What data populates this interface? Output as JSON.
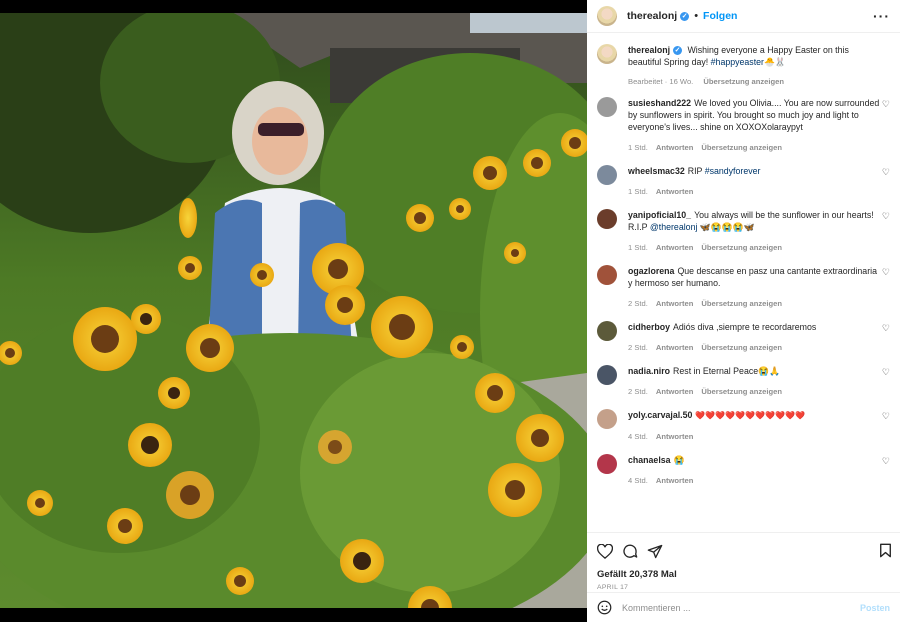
{
  "header": {
    "username": "therealonj",
    "follow_label": "Folgen",
    "more_icon": "more-horizontal-icon",
    "dot": "•"
  },
  "caption": {
    "username": "therealonj",
    "text": "Wishing everyone a Happy Easter on this beautiful Spring day!",
    "hashtag": "#happyeaster",
    "emoji": "🐣🐰",
    "edited": "Bearbeitet · 16 Wo.",
    "translate": "Übersetzung anzeigen"
  },
  "comments": [
    {
      "username": "susieshand222",
      "text": "We loved you Olivia.... You are now surrounded by sunflowers in spirit. You brought so much joy and light to everyone's lives... shine on XOXOXolaraypyt",
      "time": "1 Std.",
      "reply": "Antworten",
      "translate": "Übersetzung anzeigen",
      "avatar_color": "#9a9a9a"
    },
    {
      "username": "wheelsmac32",
      "text": "RIP ",
      "hashtag": "#sandyforever",
      "time": "1 Std.",
      "reply": "Antworten",
      "avatar_color": "#7c8a9c"
    },
    {
      "username": "yanipoficial10_",
      "text": "You always will be the sunflower in our hearts! R.I.P ",
      "mention": "@therealonj",
      "emoji": " 🦋😭😭😭🦋",
      "time": "1 Std.",
      "reply": "Antworten",
      "translate": "Übersetzung anzeigen",
      "avatar_color": "#6b3d2b"
    },
    {
      "username": "ogazlorena",
      "text": "Que descanse en pasz una cantante extraordinaria y hermoso ser humano.",
      "time": "2 Std.",
      "reply": "Antworten",
      "translate": "Übersetzung anzeigen",
      "avatar_color": "#a0523a"
    },
    {
      "username": "cidherboy",
      "text": "Adiós diva ,siempre te recordaremos",
      "time": "2 Std.",
      "reply": "Antworten",
      "translate": "Übersetzung anzeigen",
      "avatar_color": "#5c5a3a"
    },
    {
      "username": "nadia.niro",
      "text": "Rest in Eternal Peace",
      "emoji": "😭🙏",
      "time": "2 Std.",
      "reply": "Antworten",
      "translate": "Übersetzung anzeigen",
      "avatar_color": "#4a5566"
    },
    {
      "username": "yoly.carvajal.50",
      "text": "",
      "emoji": "❤️❤️❤️❤️❤️❤️❤️❤️❤️❤️❤️",
      "time": "4 Std.",
      "reply": "Antworten",
      "avatar_color": "#c4a08a"
    },
    {
      "username": "chanaelsa",
      "text": "",
      "emoji": "😭",
      "time": "4 Std.",
      "reply": "Antworten",
      "avatar_color": "#b3364a"
    }
  ],
  "actions": {
    "like_icon": "heart-icon",
    "comment_icon": "comment-icon",
    "share_icon": "send-icon",
    "save_icon": "bookmark-icon",
    "likes": "Gefällt 20,378 Mal",
    "date": "APRIL 17"
  },
  "composer": {
    "emoji_icon": "smiley-icon",
    "placeholder": "Kommentieren ...",
    "post_label": "Posten"
  },
  "colors": {
    "accent": "#0095f6",
    "link": "#00376b",
    "muted": "#8e8e8e",
    "post_disabled": "#b2dffc"
  }
}
